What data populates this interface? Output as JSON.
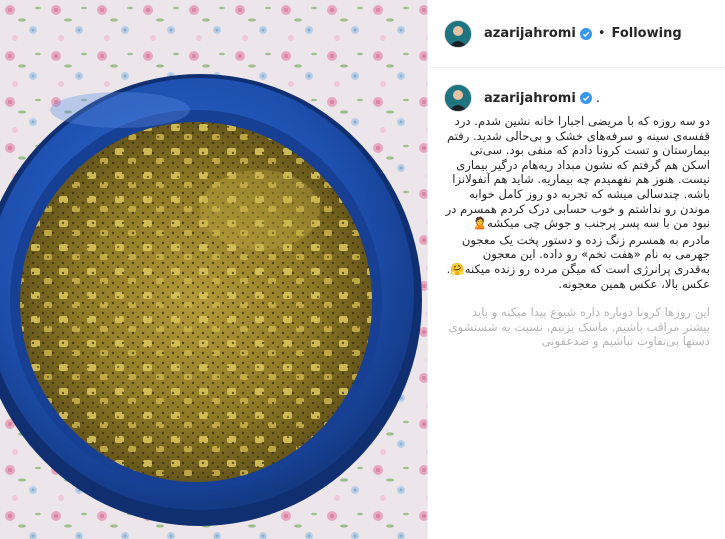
{
  "post": {
    "author": {
      "username": "azarijahromi",
      "verified": true,
      "follow_status": "Following",
      "separator": "•",
      "comment_trailing": "."
    },
    "caption": {
      "paragraph_1": "دو سه روزه که با مریضی اجبارا خانه نشین شدم. درد قفسه‌ی سینه و سرفه‌های خشک و بی‌حالی شدید. رفتم بیمارستان و تست کرونا دادم که منفی بود. سی‌تی اسکن هم گرفتم که نشون مبداد ریه‌هام درگیر بیماری نیست. هنوز هم نفهمیدم چه بیماریه. شاید هم آنفولانزا باشه. چندسالی میشه که تجربه دو روز کامل خوابه موندن رو نداشتم و خوب حسابی درک کردم همسرم در نبود من با سه پسر پرجنب و جوش چی میکشه🙎",
      "paragraph_2": "مادرم به همسرم زنگ زده و دستور پخت یک معجون جهرمی به نام «هفت تخم» رو داده. این معجون به‌قدری پرانرژی است که میگن مرده رو زنده میکنه🤗. عکس بالا، عکس همین معجونه.",
      "paragraph_3": "این روزها کرونا دوباره داره شیوع پیدا میکنه و باید بیشتر مراقب باشیم. ماسک بزنیم، نسبت به شستشوی دستها بی‌تفاوت نباشیم و ضدعفونی"
    },
    "colors": {
      "pot_blue": "#1f55b8",
      "soup": "#a08a2a"
    },
    "photo_icon": "pot-of-haft-tokhm-soup"
  }
}
